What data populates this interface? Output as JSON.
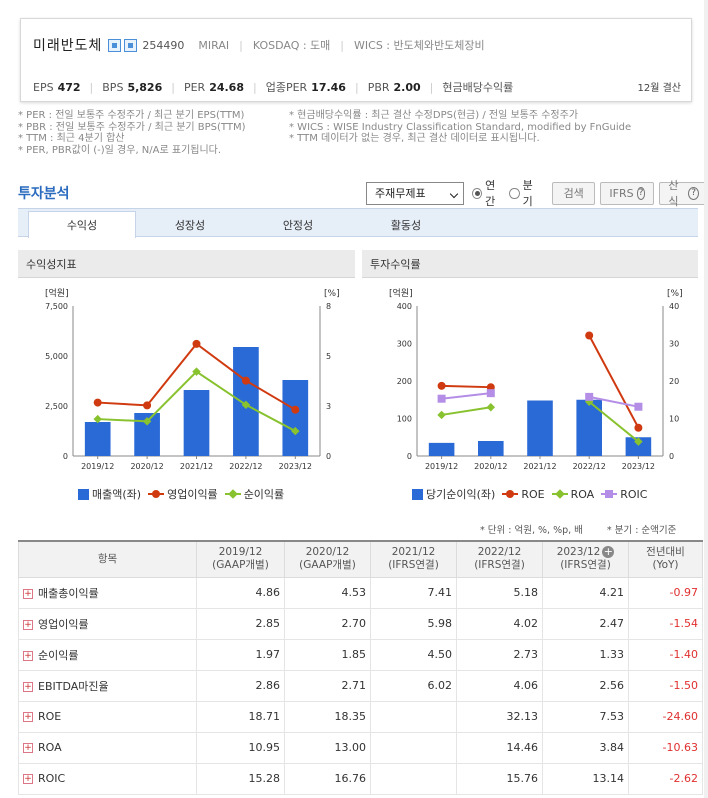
{
  "header": {
    "company_name": "미래반도체",
    "stock_code": "254490",
    "exchange_label": "MIRAI",
    "market_label": "KOSDAQ : 도매",
    "wics_label": "WICS : 반도체와반도체장비",
    "metrics": [
      {
        "label": "EPS",
        "value": "472"
      },
      {
        "label": "BPS",
        "value": "5,826"
      },
      {
        "label": "PER",
        "value": "24.68"
      },
      {
        "label": "업종PER",
        "value": "17.46"
      },
      {
        "label": "PBR",
        "value": "2.00"
      },
      {
        "label": "현금배당수익률",
        "value": ""
      }
    ],
    "settlement": "12월 결산"
  },
  "notes": {
    "left": [
      "* PER : 전일 보통주 수정주가 / 최근 분기 EPS(TTM)",
      "* PBR : 전일 보통주 수정주가 / 최근 분기 BPS(TTM)",
      "* TTM : 최근 4분기 합산",
      "* PER, PBR값이 (-)일 경우, N/A로 표기됩니다."
    ],
    "right": [
      "* 현금배당수익률 : 최근 결산 수정DPS(현금) / 전일 보통주 수정주가",
      "* WICS : WISE Industry Classification Standard, modified by FnGuide",
      "* TTM 데이터가 없는 경우, 최근 결산 데이터로 표시됩니다."
    ]
  },
  "section_title": "투자분석",
  "controls": {
    "select_value": "주재무제표",
    "radio_annual": "연간",
    "radio_quarter": "분기",
    "search_label": "검색",
    "ifrs_label": "IFRS",
    "formula_label": "산식",
    "help_glyph": "?"
  },
  "tabs": [
    "수익성",
    "성장성",
    "안정성",
    "활동성"
  ],
  "panels": {
    "left_title": "수익성지표",
    "right_title": "투자수익률"
  },
  "colors": {
    "bar": "#2a6ad6",
    "red": "#d03a10",
    "green": "#88c22e",
    "purple": "#b48ee6"
  },
  "chart_data": [
    {
      "type": "bar",
      "categories": [
        "2019/12",
        "2020/12",
        "2021/12",
        "2022/12",
        "2023/12"
      ],
      "ylabel": "[억원]",
      "y2label": "[%]",
      "ylim": [
        0,
        7500
      ],
      "y2lim": [
        0,
        8
      ],
      "yticks": [
        "0",
        "2,500",
        "5,000",
        "7,500"
      ],
      "y2ticks": [
        "0",
        "3",
        "5",
        "8"
      ],
      "bars": {
        "name": "매출액(좌)",
        "values": [
          1700,
          2150,
          3300,
          5450,
          3800
        ]
      },
      "lines": [
        {
          "name": "영업이익률",
          "color": "red",
          "marker": "circle",
          "values": [
            2.85,
            2.7,
            5.98,
            4.02,
            2.47
          ]
        },
        {
          "name": "순이익률",
          "color": "green",
          "marker": "diamond",
          "values": [
            1.97,
            1.85,
            4.5,
            2.73,
            1.33
          ]
        }
      ],
      "grid": false
    },
    {
      "type": "bar",
      "categories": [
        "2019/12",
        "2020/12",
        "2021/12",
        "2022/12",
        "2023/12"
      ],
      "ylabel": "[억원]",
      "y2label": "[%]",
      "ylim": [
        0,
        400
      ],
      "y2lim": [
        0,
        40
      ],
      "yticks": [
        "0",
        "100",
        "200",
        "300",
        "400"
      ],
      "y2ticks": [
        "0",
        "10",
        "20",
        "30",
        "40"
      ],
      "bars": {
        "name": "당기순이익(좌)",
        "values": [
          35,
          40,
          148,
          150,
          50
        ]
      },
      "lines": [
        {
          "name": "ROE",
          "color": "red",
          "marker": "circle",
          "values": [
            18.71,
            18.35,
            null,
            32.13,
            7.53
          ]
        },
        {
          "name": "ROA",
          "color": "green",
          "marker": "diamond",
          "values": [
            10.95,
            13.0,
            null,
            14.46,
            3.84
          ]
        },
        {
          "name": "ROIC",
          "color": "purple",
          "marker": "square",
          "values": [
            15.28,
            16.76,
            null,
            15.76,
            13.14
          ]
        }
      ],
      "grid": false
    }
  ],
  "unit_note": "* 단위 : 억원, %, %p, 배",
  "quarter_note": "* 분기 : 순액기준",
  "table": {
    "headers": [
      {
        "l1": "항목",
        "l2": ""
      },
      {
        "l1": "2019/12",
        "l2": "(GAAP개별)"
      },
      {
        "l1": "2020/12",
        "l2": "(GAAP개별)"
      },
      {
        "l1": "2021/12",
        "l2": "(IFRS연결)"
      },
      {
        "l1": "2022/12",
        "l2": "(IFRS연결)"
      },
      {
        "l1": "2023/12",
        "l2": "(IFRS연결)"
      },
      {
        "l1": "전년대비",
        "l2": "(YoY)"
      }
    ],
    "rows": [
      {
        "label": "매출총이익률",
        "values": [
          "4.86",
          "4.53",
          "7.41",
          "5.18",
          "4.21"
        ],
        "yoy": "-0.97"
      },
      {
        "label": "영업이익률",
        "values": [
          "2.85",
          "2.70",
          "5.98",
          "4.02",
          "2.47"
        ],
        "yoy": "-1.54"
      },
      {
        "label": "순이익률",
        "values": [
          "1.97",
          "1.85",
          "4.50",
          "2.73",
          "1.33"
        ],
        "yoy": "-1.40"
      },
      {
        "label": "EBITDA마진율",
        "values": [
          "2.86",
          "2.71",
          "6.02",
          "4.06",
          "2.56"
        ],
        "yoy": "-1.50"
      },
      {
        "label": "ROE",
        "values": [
          "18.71",
          "18.35",
          "",
          "32.13",
          "7.53"
        ],
        "yoy": "-24.60"
      },
      {
        "label": "ROA",
        "values": [
          "10.95",
          "13.00",
          "",
          "14.46",
          "3.84"
        ],
        "yoy": "-10.63"
      },
      {
        "label": "ROIC",
        "values": [
          "15.28",
          "16.76",
          "",
          "15.76",
          "13.14"
        ],
        "yoy": "-2.62"
      }
    ]
  }
}
